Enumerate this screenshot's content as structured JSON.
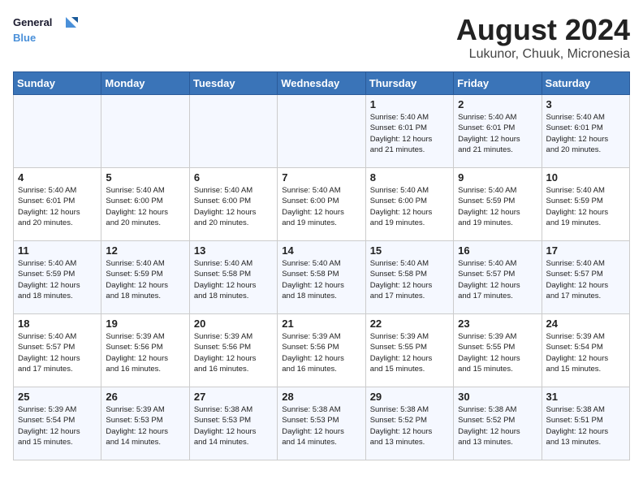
{
  "logo": {
    "line1": "General",
    "line2": "Blue"
  },
  "title": "August 2024",
  "subtitle": "Lukunor, Chuuk, Micronesia",
  "headers": [
    "Sunday",
    "Monday",
    "Tuesday",
    "Wednesday",
    "Thursday",
    "Friday",
    "Saturday"
  ],
  "weeks": [
    [
      {
        "day": "",
        "info": ""
      },
      {
        "day": "",
        "info": ""
      },
      {
        "day": "",
        "info": ""
      },
      {
        "day": "",
        "info": ""
      },
      {
        "day": "1",
        "info": "Sunrise: 5:40 AM\nSunset: 6:01 PM\nDaylight: 12 hours\nand 21 minutes."
      },
      {
        "day": "2",
        "info": "Sunrise: 5:40 AM\nSunset: 6:01 PM\nDaylight: 12 hours\nand 21 minutes."
      },
      {
        "day": "3",
        "info": "Sunrise: 5:40 AM\nSunset: 6:01 PM\nDaylight: 12 hours\nand 20 minutes."
      }
    ],
    [
      {
        "day": "4",
        "info": "Sunrise: 5:40 AM\nSunset: 6:01 PM\nDaylight: 12 hours\nand 20 minutes."
      },
      {
        "day": "5",
        "info": "Sunrise: 5:40 AM\nSunset: 6:00 PM\nDaylight: 12 hours\nand 20 minutes."
      },
      {
        "day": "6",
        "info": "Sunrise: 5:40 AM\nSunset: 6:00 PM\nDaylight: 12 hours\nand 20 minutes."
      },
      {
        "day": "7",
        "info": "Sunrise: 5:40 AM\nSunset: 6:00 PM\nDaylight: 12 hours\nand 19 minutes."
      },
      {
        "day": "8",
        "info": "Sunrise: 5:40 AM\nSunset: 6:00 PM\nDaylight: 12 hours\nand 19 minutes."
      },
      {
        "day": "9",
        "info": "Sunrise: 5:40 AM\nSunset: 5:59 PM\nDaylight: 12 hours\nand 19 minutes."
      },
      {
        "day": "10",
        "info": "Sunrise: 5:40 AM\nSunset: 5:59 PM\nDaylight: 12 hours\nand 19 minutes."
      }
    ],
    [
      {
        "day": "11",
        "info": "Sunrise: 5:40 AM\nSunset: 5:59 PM\nDaylight: 12 hours\nand 18 minutes."
      },
      {
        "day": "12",
        "info": "Sunrise: 5:40 AM\nSunset: 5:59 PM\nDaylight: 12 hours\nand 18 minutes."
      },
      {
        "day": "13",
        "info": "Sunrise: 5:40 AM\nSunset: 5:58 PM\nDaylight: 12 hours\nand 18 minutes."
      },
      {
        "day": "14",
        "info": "Sunrise: 5:40 AM\nSunset: 5:58 PM\nDaylight: 12 hours\nand 18 minutes."
      },
      {
        "day": "15",
        "info": "Sunrise: 5:40 AM\nSunset: 5:58 PM\nDaylight: 12 hours\nand 17 minutes."
      },
      {
        "day": "16",
        "info": "Sunrise: 5:40 AM\nSunset: 5:57 PM\nDaylight: 12 hours\nand 17 minutes."
      },
      {
        "day": "17",
        "info": "Sunrise: 5:40 AM\nSunset: 5:57 PM\nDaylight: 12 hours\nand 17 minutes."
      }
    ],
    [
      {
        "day": "18",
        "info": "Sunrise: 5:40 AM\nSunset: 5:57 PM\nDaylight: 12 hours\nand 17 minutes."
      },
      {
        "day": "19",
        "info": "Sunrise: 5:39 AM\nSunset: 5:56 PM\nDaylight: 12 hours\nand 16 minutes."
      },
      {
        "day": "20",
        "info": "Sunrise: 5:39 AM\nSunset: 5:56 PM\nDaylight: 12 hours\nand 16 minutes."
      },
      {
        "day": "21",
        "info": "Sunrise: 5:39 AM\nSunset: 5:56 PM\nDaylight: 12 hours\nand 16 minutes."
      },
      {
        "day": "22",
        "info": "Sunrise: 5:39 AM\nSunset: 5:55 PM\nDaylight: 12 hours\nand 15 minutes."
      },
      {
        "day": "23",
        "info": "Sunrise: 5:39 AM\nSunset: 5:55 PM\nDaylight: 12 hours\nand 15 minutes."
      },
      {
        "day": "24",
        "info": "Sunrise: 5:39 AM\nSunset: 5:54 PM\nDaylight: 12 hours\nand 15 minutes."
      }
    ],
    [
      {
        "day": "25",
        "info": "Sunrise: 5:39 AM\nSunset: 5:54 PM\nDaylight: 12 hours\nand 15 minutes."
      },
      {
        "day": "26",
        "info": "Sunrise: 5:39 AM\nSunset: 5:53 PM\nDaylight: 12 hours\nand 14 minutes."
      },
      {
        "day": "27",
        "info": "Sunrise: 5:38 AM\nSunset: 5:53 PM\nDaylight: 12 hours\nand 14 minutes."
      },
      {
        "day": "28",
        "info": "Sunrise: 5:38 AM\nSunset: 5:53 PM\nDaylight: 12 hours\nand 14 minutes."
      },
      {
        "day": "29",
        "info": "Sunrise: 5:38 AM\nSunset: 5:52 PM\nDaylight: 12 hours\nand 13 minutes."
      },
      {
        "day": "30",
        "info": "Sunrise: 5:38 AM\nSunset: 5:52 PM\nDaylight: 12 hours\nand 13 minutes."
      },
      {
        "day": "31",
        "info": "Sunrise: 5:38 AM\nSunset: 5:51 PM\nDaylight: 12 hours\nand 13 minutes."
      }
    ]
  ]
}
